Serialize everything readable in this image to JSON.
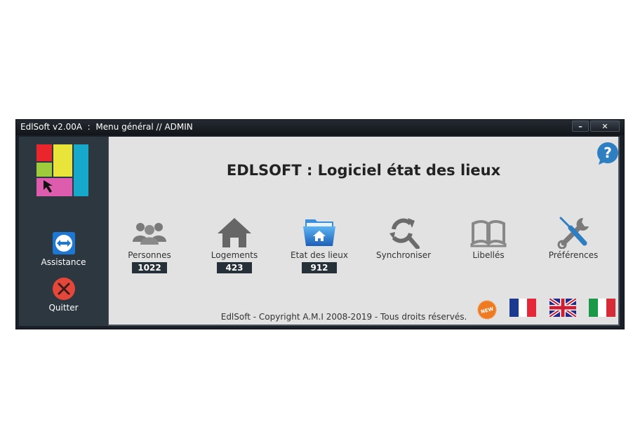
{
  "window": {
    "title": "EdlSoft v2.00A  :  Menu général // ADMIN",
    "minimize_label": "–",
    "close_label": "✕"
  },
  "sidebar": {
    "logo": "edlsoft-logo",
    "items": [
      {
        "label": "Assistance",
        "icon": "teamviewer-icon"
      },
      {
        "label": "Quitter",
        "icon": "close-circle-icon"
      }
    ]
  },
  "main": {
    "heading": "EDLSOFT : Logiciel état des lieux",
    "help_icon": "help-bubble-icon",
    "tiles": [
      {
        "label": "Personnes",
        "count": "1022",
        "icon": "people-icon"
      },
      {
        "label": "Logements",
        "count": "423",
        "icon": "house-icon"
      },
      {
        "label": "Etat des lieux",
        "count": "912",
        "icon": "folder-house-icon"
      },
      {
        "label": "Synchroniser",
        "icon": "sync-search-icon"
      },
      {
        "label": "Libellés",
        "icon": "book-icon"
      },
      {
        "label": "Préférences",
        "icon": "tools-icon"
      }
    ],
    "footer": "EdlSoft - Copyright A.M.I 2008-2019 - Tous droits réservés.",
    "new_badge": "NEW",
    "languages": [
      "fr",
      "en",
      "it"
    ]
  },
  "colors": {
    "sidebar": "#2d3740",
    "content": "#e2e2e2",
    "count_bg": "#263038",
    "icon_gray": "#6b6b6b",
    "accent_blue": "#2a7fc4"
  }
}
